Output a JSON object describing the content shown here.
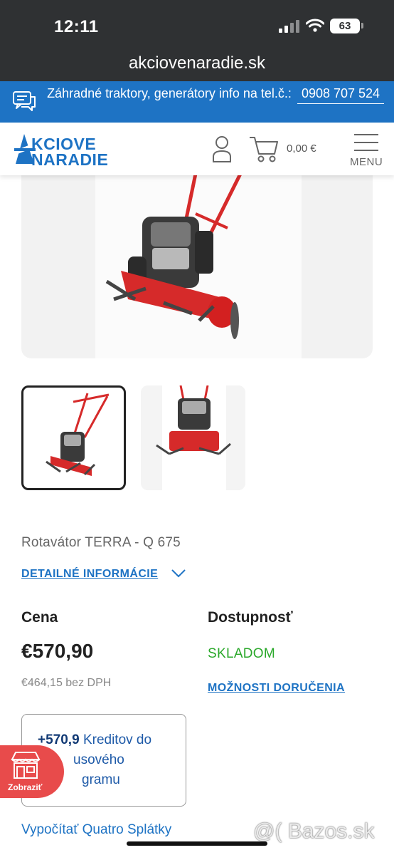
{
  "status_bar": {
    "time": "12:11",
    "battery": "63"
  },
  "browser": {
    "url": "akciovenaradie.sk"
  },
  "info_strip": {
    "text": "Záhradné traktory, generátory info na tel.č.:",
    "phone": "0908 707 524"
  },
  "header": {
    "logo_line1": "KCIOVE",
    "logo_line2": "NARADIE",
    "cart_total": "0,00 €",
    "menu_label": "MENU"
  },
  "product": {
    "title": "Rotavátor TERRA - Q 675",
    "details_link": "DETAILNÉ INFORMÁCIE",
    "price_heading": "Cena",
    "price": "€570,90",
    "price_net": "€464,15 bez DPH",
    "availability_heading": "Dostupnosť",
    "availability_status": "SKLADOM",
    "delivery_link": "MOŽNOSTI DORUČENIA",
    "credits_amount": "+570,9",
    "credits_line1": "Kreditov do",
    "credits_line2": "usového",
    "credits_line3": "gramu",
    "installments_link": "Vypočítať Quatro Splátky"
  },
  "floating_badge": {
    "label": "Zobraziť"
  },
  "watermark": "@( Bazos.sk",
  "colors": {
    "brand_blue": "#1e73c4",
    "stock_green": "#2aa82a",
    "badge_red": "#e84b4b"
  }
}
